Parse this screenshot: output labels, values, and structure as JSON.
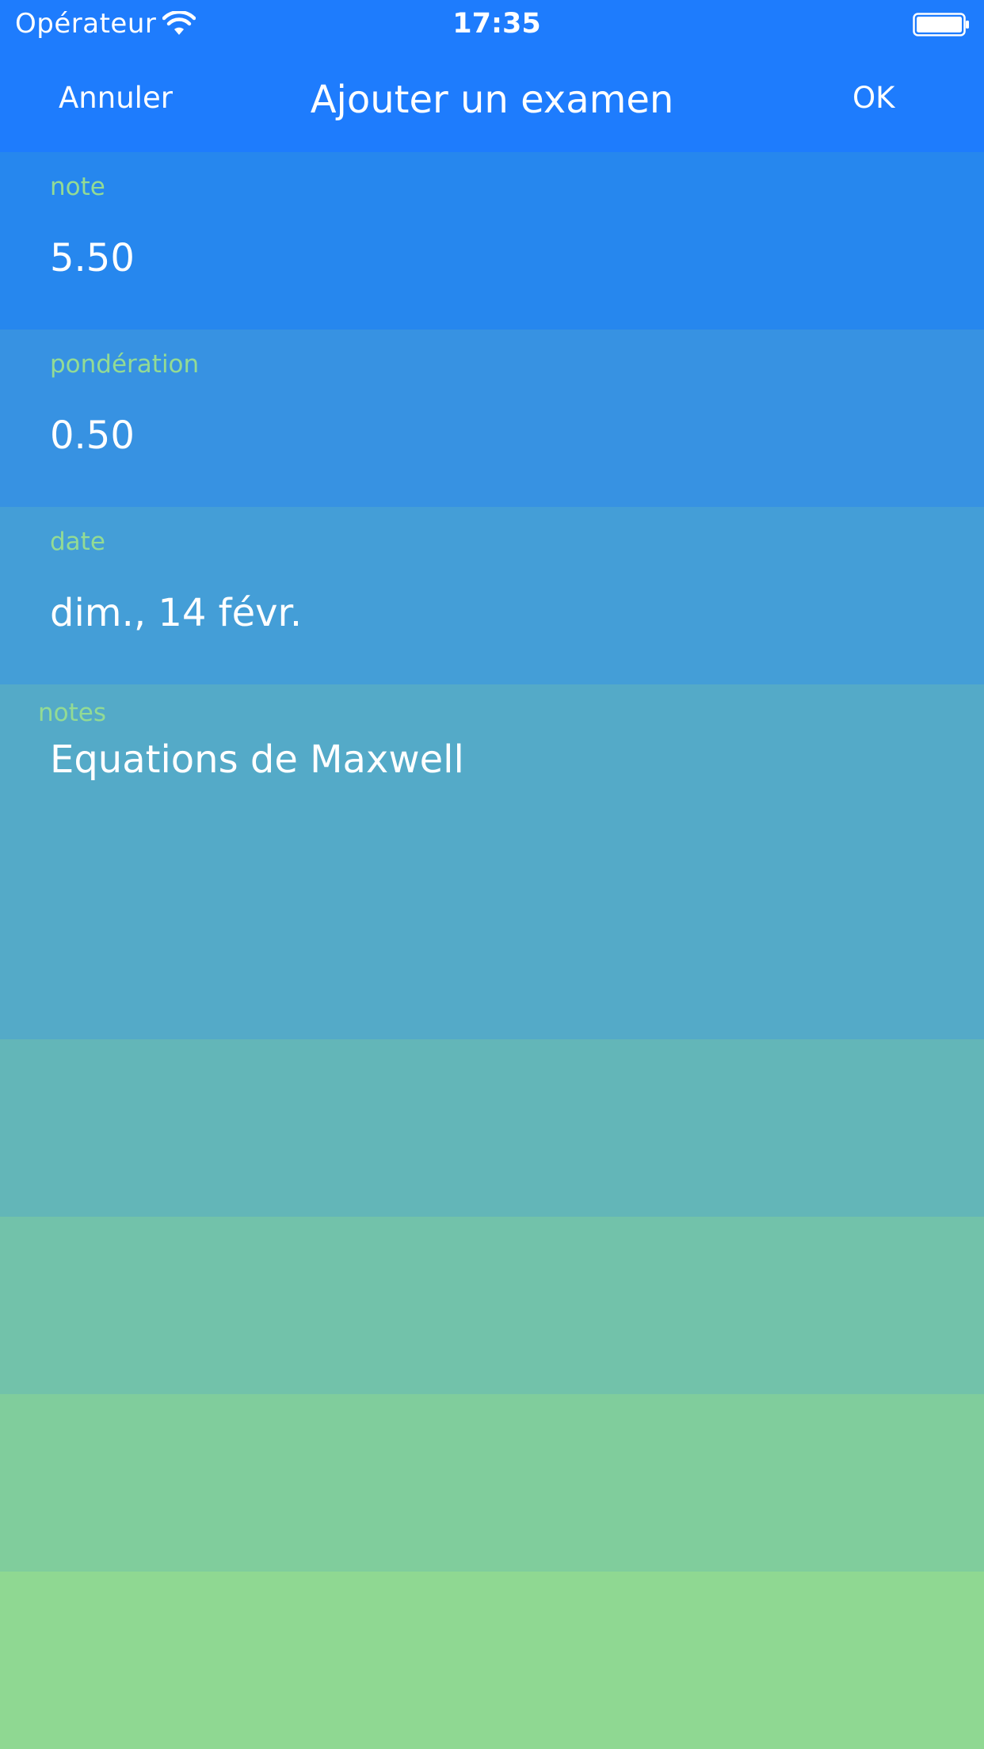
{
  "status_bar": {
    "carrier": "Opérateur",
    "time": "17:35",
    "wifi_icon": "wifi-icon",
    "battery_icon": "battery-full-icon"
  },
  "nav": {
    "cancel_label": "Annuler",
    "title": "Ajouter un examen",
    "done_label": "OK"
  },
  "form": {
    "grade": {
      "label": "note",
      "value": "5.50"
    },
    "weight": {
      "label": "pondération",
      "value": "0.50"
    },
    "date": {
      "label": "date",
      "value": "dim., 14 févr."
    },
    "notes": {
      "label": "notes",
      "value": "Equations de Maxwell"
    }
  },
  "colors": {
    "header": "#1e7cfd",
    "label": "#93db94",
    "row_gradient": [
      "#2687ee",
      "#3792e2",
      "#449ed7",
      "#54aac8",
      "#63b6b8",
      "#72c2aa",
      "#80cd9c",
      "#8fd892"
    ]
  }
}
